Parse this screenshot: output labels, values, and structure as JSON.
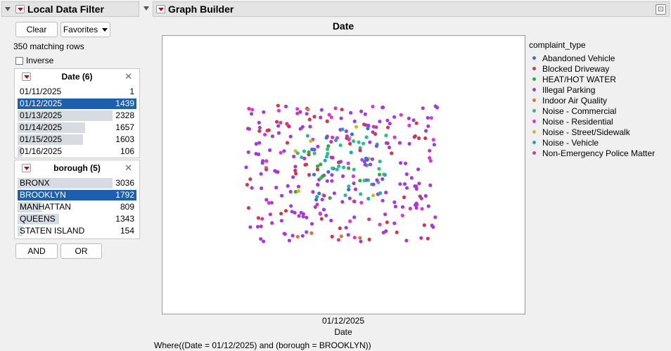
{
  "filter_panel": {
    "title": "Local Data Filter",
    "clear_label": "Clear",
    "favorites_label": "Favorites",
    "matching_rows": "350 matching rows",
    "inverse_label": "Inverse",
    "date_filter": {
      "title": "Date (6)",
      "rows": [
        {
          "label": "01/11/2025",
          "count": "1",
          "fraction": 0.0,
          "selected": false
        },
        {
          "label": "01/12/2025",
          "count": "1439",
          "fraction": 0.49,
          "selected": true
        },
        {
          "label": "01/13/2025",
          "count": "2328",
          "fraction": 0.8,
          "selected": false
        },
        {
          "label": "01/14/2025",
          "count": "1657",
          "fraction": 0.57,
          "selected": false
        },
        {
          "label": "01/15/2025",
          "count": "1603",
          "fraction": 0.55,
          "selected": false
        },
        {
          "label": "01/16/2025",
          "count": "106",
          "fraction": 0.04,
          "selected": false
        }
      ]
    },
    "borough_filter": {
      "title": "borough (5)",
      "rows": [
        {
          "label": "BRONX",
          "count": "3036",
          "fraction": 0.8,
          "selected": false
        },
        {
          "label": "BROOKLYN",
          "count": "1792",
          "fraction": 0.47,
          "selected": true
        },
        {
          "label": "MANHATTAN",
          "count": "809",
          "fraction": 0.21,
          "selected": false
        },
        {
          "label": "QUEENS",
          "count": "1343",
          "fraction": 0.35,
          "selected": false
        },
        {
          "label": "STATEN ISLAND",
          "count": "154",
          "fraction": 0.04,
          "selected": false
        }
      ]
    },
    "and_label": "AND",
    "or_label": "OR"
  },
  "graph": {
    "panel_title": "Graph Builder",
    "title": "Date",
    "x_tick": "01/12/2025",
    "x_label": "Date",
    "where_clause": "Where((Date = 01/12/2025) and (borough = BROOKLYN))",
    "legend_title": "complaint_type",
    "legend": [
      {
        "name": "Abandoned Vehicle",
        "color": "#3a6fd8"
      },
      {
        "name": "Blocked Driveway",
        "color": "#d0374a"
      },
      {
        "name": "HEAT/HOT WATER",
        "color": "#3aa83a"
      },
      {
        "name": "Illegal Parking",
        "color": "#a63ad8"
      },
      {
        "name": "Indoor Air Quality",
        "color": "#d9763a"
      },
      {
        "name": "Noise - Commercial",
        "color": "#2fb89a"
      },
      {
        "name": "Noise - Residential",
        "color": "#d63ad6"
      },
      {
        "name": "Noise - Street/Sidewalk",
        "color": "#c6bd2a"
      },
      {
        "name": "Noise - Vehicle",
        "color": "#1fa7b5"
      },
      {
        "name": "Non-Emergency Police Matter",
        "color": "#d43a9a"
      }
    ]
  }
}
